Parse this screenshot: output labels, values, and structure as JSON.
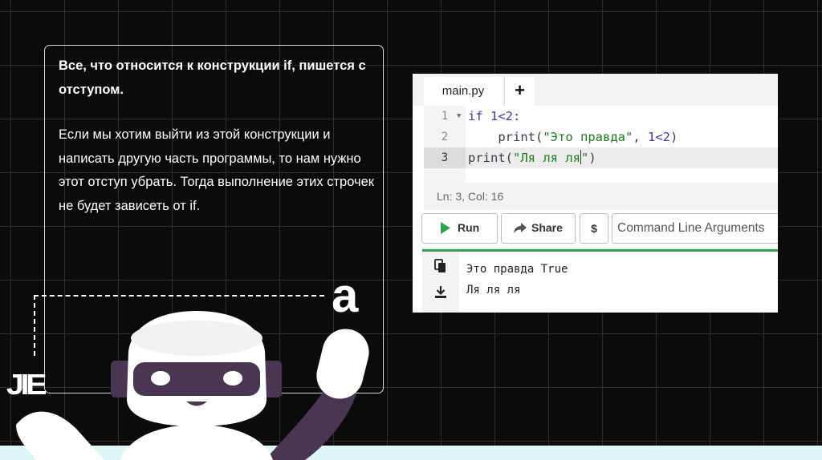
{
  "slide": {
    "heading": "Все, что относится к конструкции if, пишется с отступом.",
    "body": "Если мы хотим выйти из этой конструкции и написать другую часть программы, то нам нужно этот отступ убрать. Тогда выполнение этих строчек не будет зависеть от if.",
    "letter": "a",
    "logo": "JIE"
  },
  "ide": {
    "tab_label": "main.py",
    "add_tab_label": "+",
    "line_numbers": [
      "1",
      "2",
      "3"
    ],
    "code": {
      "l1_kw": "if ",
      "l1_num": "1<2",
      "l1_end": ":",
      "l2_indent": "    ",
      "l2_fn": "print(",
      "l2_str": "\"Это правда\"",
      "l2_sep": ", ",
      "l2_num": "1<2",
      "l2_end": ")",
      "l3_fn": "print(",
      "l3_str_a": "\"Ля ля ля",
      "l3_str_b": "\"",
      "l3_end": ")"
    },
    "status": "Ln: 3,  Col: 16",
    "run_label": "Run",
    "share_label": "Share",
    "dollar_label": "$",
    "args_placeholder": "Command Line Arguments",
    "output_lines": [
      "Это правда True",
      "Ля ля ля"
    ]
  },
  "colors": {
    "accent_green": "#2ea44f",
    "background": "#0b0b0b",
    "robot_purple": "#4a3552"
  },
  "icons": {
    "run": "play-icon",
    "share": "share-arrow-icon",
    "copy": "copy-icon",
    "download": "download-icon",
    "fold": "chevron-down-icon"
  }
}
